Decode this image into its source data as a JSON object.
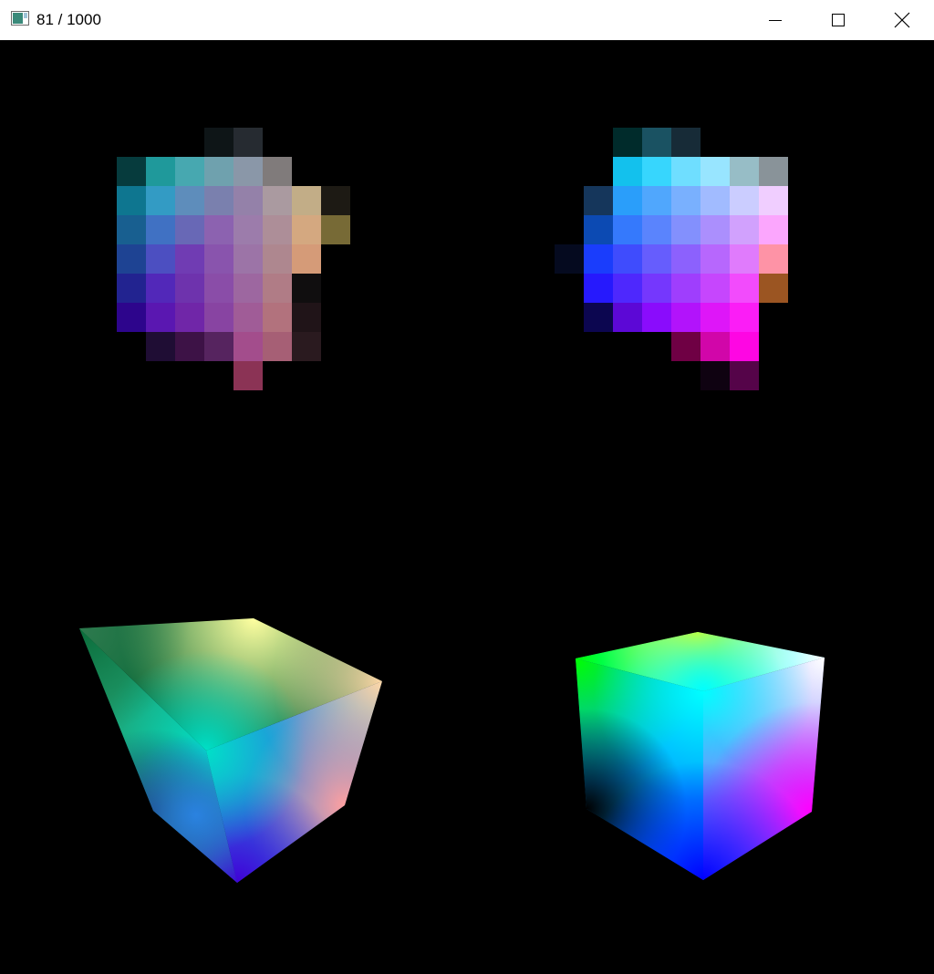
{
  "window": {
    "title": "81 / 1000",
    "app_icon": "app-window-icon",
    "controls": [
      "minimize-icon",
      "maximize-icon",
      "close-icon"
    ]
  },
  "scene": {
    "background": "#000000",
    "palette_grids": [
      {
        "name": "left",
        "cells": [
          [
            3,
            0,
            "#0e1517"
          ],
          [
            4,
            0,
            "#262b31"
          ],
          [
            0,
            1,
            "#063b3d"
          ],
          [
            1,
            1,
            "#1f999b"
          ],
          [
            2,
            1,
            "#47a8b0"
          ],
          [
            3,
            1,
            "#6fa1ae"
          ],
          [
            4,
            1,
            "#8a97a8"
          ],
          [
            5,
            1,
            "#807b7b"
          ],
          [
            0,
            2,
            "#0e7690"
          ],
          [
            1,
            2,
            "#339bc4"
          ],
          [
            2,
            2,
            "#5e8dbb"
          ],
          [
            3,
            2,
            "#7a80ae"
          ],
          [
            4,
            2,
            "#9481a9"
          ],
          [
            5,
            2,
            "#aa9aa0"
          ],
          [
            6,
            2,
            "#c2ad87"
          ],
          [
            7,
            2,
            "#1d1a14"
          ],
          [
            0,
            3,
            "#185f90"
          ],
          [
            1,
            3,
            "#4071c3"
          ],
          [
            2,
            3,
            "#6868b6"
          ],
          [
            3,
            3,
            "#8c62b0"
          ],
          [
            4,
            3,
            "#9c7cab"
          ],
          [
            5,
            3,
            "#ad8e98"
          ],
          [
            6,
            3,
            "#d4a880"
          ],
          [
            7,
            3,
            "#776a36"
          ],
          [
            0,
            4,
            "#1e4393"
          ],
          [
            1,
            4,
            "#4c4fc1"
          ],
          [
            2,
            4,
            "#703cb3"
          ],
          [
            3,
            4,
            "#8954ad"
          ],
          [
            4,
            4,
            "#9c74a7"
          ],
          [
            5,
            4,
            "#ae878f"
          ],
          [
            6,
            4,
            "#d59b78"
          ],
          [
            0,
            5,
            "#222390"
          ],
          [
            1,
            5,
            "#5228b9"
          ],
          [
            2,
            5,
            "#6e33ad"
          ],
          [
            3,
            5,
            "#8a4da8"
          ],
          [
            4,
            5,
            "#9d67a0"
          ],
          [
            5,
            5,
            "#b07c86"
          ],
          [
            6,
            5,
            "#100e0f"
          ],
          [
            0,
            6,
            "#2d058c"
          ],
          [
            1,
            6,
            "#5a17b1"
          ],
          [
            2,
            6,
            "#7026a8"
          ],
          [
            3,
            6,
            "#8844a2"
          ],
          [
            4,
            6,
            "#a05c97"
          ],
          [
            5,
            6,
            "#b2727d"
          ],
          [
            6,
            6,
            "#201418"
          ],
          [
            1,
            7,
            "#1f0d34"
          ],
          [
            2,
            7,
            "#3d1246"
          ],
          [
            3,
            7,
            "#56245f"
          ],
          [
            4,
            7,
            "#a34d8c"
          ],
          [
            5,
            7,
            "#a65f75"
          ],
          [
            6,
            7,
            "#2a1a1f"
          ],
          [
            4,
            8,
            "#8b3355"
          ]
        ]
      },
      {
        "name": "right",
        "cells": [
          [
            2,
            0,
            "#002b2b"
          ],
          [
            3,
            0,
            "#1a5262"
          ],
          [
            4,
            0,
            "#172b37"
          ],
          [
            2,
            1,
            "#13c1ed"
          ],
          [
            3,
            1,
            "#37d6fd"
          ],
          [
            4,
            1,
            "#6fdeff"
          ],
          [
            5,
            1,
            "#98e5ff"
          ],
          [
            6,
            1,
            "#97bdc6"
          ],
          [
            7,
            1,
            "#899399"
          ],
          [
            1,
            2,
            "#15365b"
          ],
          [
            2,
            2,
            "#2a9efa"
          ],
          [
            3,
            2,
            "#50a7fd"
          ],
          [
            4,
            2,
            "#79b0fe"
          ],
          [
            5,
            2,
            "#a1bbff"
          ],
          [
            6,
            2,
            "#cbcdff"
          ],
          [
            7,
            2,
            "#f0ceff"
          ],
          [
            1,
            3,
            "#0c4ab3"
          ],
          [
            2,
            3,
            "#3579fc"
          ],
          [
            3,
            3,
            "#5a84fd"
          ],
          [
            4,
            3,
            "#8390fd"
          ],
          [
            5,
            3,
            "#ab8ffd"
          ],
          [
            6,
            3,
            "#d1a1fd"
          ],
          [
            7,
            3,
            "#fba6fd"
          ],
          [
            0,
            4,
            "#050a1f"
          ],
          [
            1,
            4,
            "#1a3dfc"
          ],
          [
            2,
            4,
            "#3f4cfd"
          ],
          [
            3,
            4,
            "#665dfd"
          ],
          [
            4,
            4,
            "#8c61fd"
          ],
          [
            5,
            4,
            "#b767fd"
          ],
          [
            6,
            4,
            "#e07bfc"
          ],
          [
            7,
            4,
            "#fe93a6"
          ],
          [
            1,
            5,
            "#2619fd"
          ],
          [
            2,
            5,
            "#4e28fd"
          ],
          [
            3,
            5,
            "#7537fd"
          ],
          [
            4,
            5,
            "#9f3efd"
          ],
          [
            5,
            5,
            "#c646fd"
          ],
          [
            6,
            5,
            "#f24bfc"
          ],
          [
            7,
            5,
            "#9b5522"
          ],
          [
            1,
            6,
            "#0c0650"
          ],
          [
            2,
            6,
            "#5c08d6"
          ],
          [
            3,
            6,
            "#8a0cfc"
          ],
          [
            4,
            6,
            "#b213fb"
          ],
          [
            5,
            6,
            "#de16f8"
          ],
          [
            6,
            6,
            "#fb1df6"
          ],
          [
            4,
            7,
            "#6f0044"
          ],
          [
            5,
            7,
            "#d106a9"
          ],
          [
            6,
            7,
            "#fe06e3"
          ],
          [
            5,
            8,
            "#0f0211"
          ],
          [
            6,
            8,
            "#550449"
          ]
        ]
      }
    ],
    "cubes": [
      {
        "name": "left",
        "colors": {
          "top_back": "#2e7a4e",
          "top_right": "#ffffa0",
          "top_left": "#0c6c3a",
          "right_upper": "#ffd7a6",
          "center": "#00e0c8",
          "mid_left": "#20a070",
          "lower_center": "#2a82e0",
          "right_lower": "#ffa0a0",
          "bottom": "#4000d8",
          "lower_left": "#1a3a6a"
        }
      },
      {
        "name": "right",
        "colors": {
          "top_left": "#00ff00",
          "top_right": "#ffffff",
          "top_back": "#ffff00",
          "center": "#00ffff",
          "bottom_left": "#000000",
          "bottom_right": "#ff00ff",
          "bottom": "#0000ff"
        }
      }
    ]
  }
}
